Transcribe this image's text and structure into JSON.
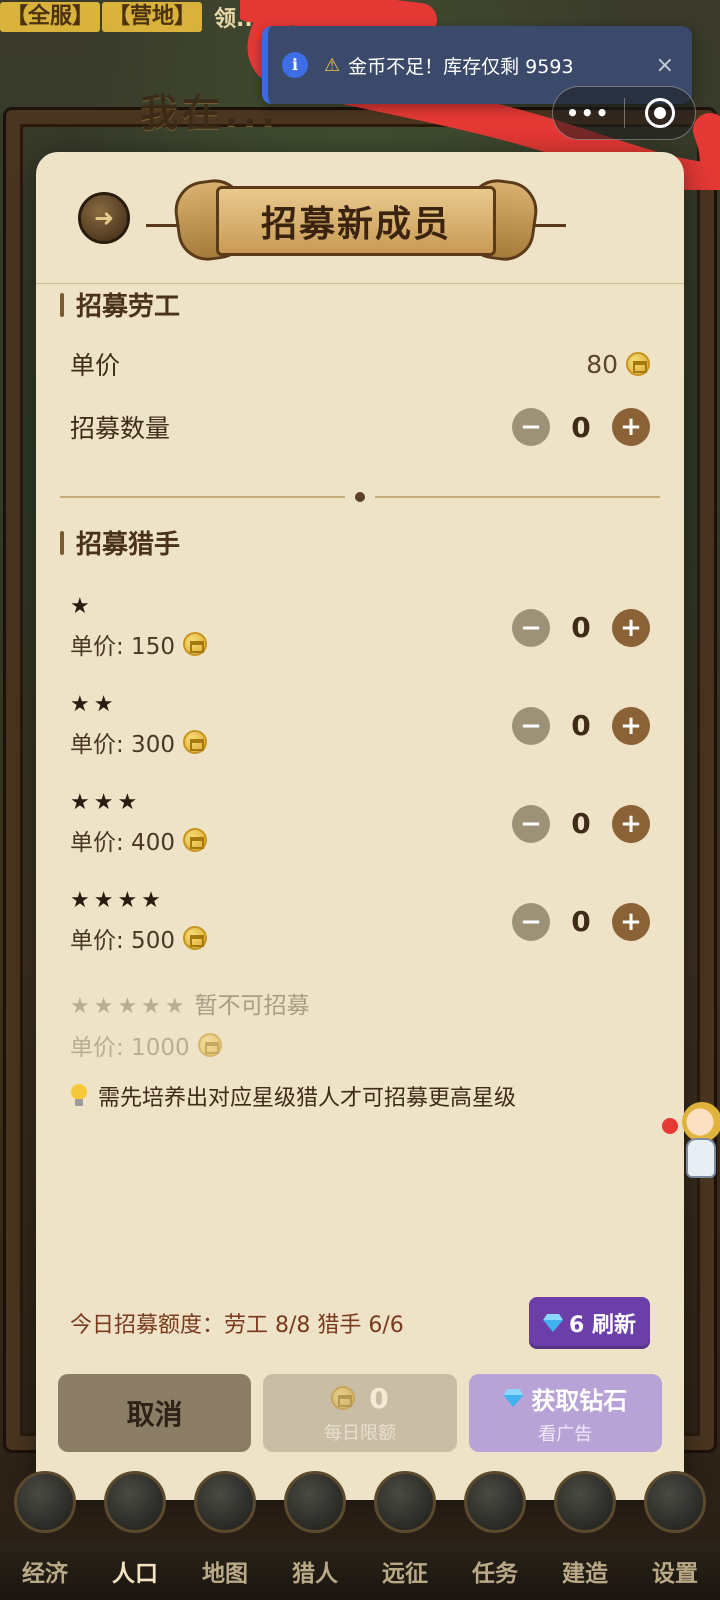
{
  "background": {
    "ticker_tags": [
      "【全服】",
      "【营地】"
    ],
    "ticker_message": "领...",
    "banner_title": "我在...",
    "bottom_nav": [
      "经济",
      "人口",
      "地图",
      "猎人",
      "远征",
      "任务",
      "建造",
      "设置"
    ],
    "active_nav": "人口"
  },
  "toast": {
    "icon": "info-icon",
    "warning_icon": "warning-icon",
    "text": "金币不足！库存仅剩 9593",
    "close_label": "×"
  },
  "capsule": {
    "more_icon": "more-dots-icon",
    "close_icon": "target-circle-icon"
  },
  "modal": {
    "title": "招募新成员",
    "back_icon": "back-arrow-icon",
    "worker_section": {
      "title": "招募劳工",
      "unit_price_label": "单价",
      "unit_price": "80",
      "quantity_label": "招募数量",
      "quantity": "0"
    },
    "hunter_section": {
      "title": "招募猎手",
      "tiers": [
        {
          "stars": "★",
          "price": "单价: 150",
          "quantity": "0"
        },
        {
          "stars": "★★",
          "price": "单价: 300",
          "quantity": "0"
        },
        {
          "stars": "★★★",
          "price": "单价: 400",
          "quantity": "0"
        },
        {
          "stars": "★★★★",
          "price": "单价: 500",
          "quantity": "0"
        }
      ],
      "locked_tier": {
        "stars": "★★★★★",
        "note": "暂不可招募",
        "price": "单价: 1000"
      }
    },
    "tip": "需先培养出对应星级猎人才可招募更高星级",
    "quota_text": "今日招募额度：劳工 8/8  猎手 6/6",
    "refresh_button": "6 刷新",
    "buttons": {
      "cancel": "取消",
      "confirm_value": "0",
      "confirm_sub": "每日限额",
      "get_diamonds": "获取钻石",
      "get_diamonds_sub": "看广告"
    }
  },
  "colors": {
    "modal_bg": "#efe3c7",
    "accent_brown": "#8a6236",
    "refresh_purple": "#6c3fa8",
    "toast_bg": "#3b4a6a",
    "scribble_red": "#e53935"
  }
}
